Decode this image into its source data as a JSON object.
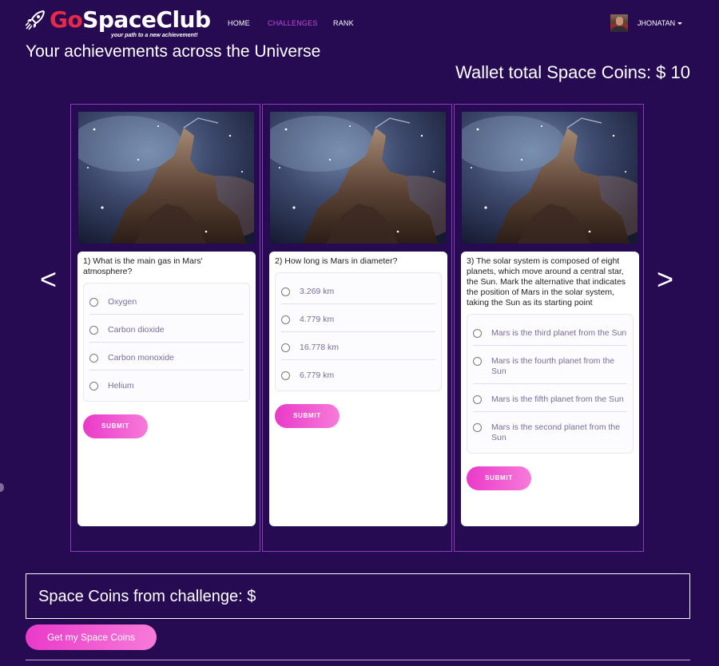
{
  "brand": {
    "prefix": "Go",
    "name": "SpaceClub",
    "tagline": "your path to a new achievement!"
  },
  "nav": {
    "items": [
      {
        "label": "HOME",
        "active": false
      },
      {
        "label": "CHALLENGES",
        "active": true
      },
      {
        "label": "RANK",
        "active": false
      }
    ],
    "user_name": "JHONATAN"
  },
  "headline": "Your achievements across the Universe",
  "wallet": {
    "label": "Wallet total Space Coins: $ 10"
  },
  "carousel": {
    "prev_label": "<",
    "next_label": ">",
    "challenges": [
      {
        "question": "1) What is the main gas in Mars' atmosphere?",
        "options": [
          "Oxygen",
          "Carbon dioxide",
          "Carbon monoxide",
          "Helium"
        ],
        "submit_label": "SUBMIT"
      },
      {
        "question": "2) How long is Mars in diameter?",
        "options": [
          "3.269 km",
          "4.779 km",
          "16.778 km",
          "6.779 km"
        ],
        "submit_label": "SUBMIT"
      },
      {
        "question": "3) The solar system is composed of eight planets, which move around a central star, the Sun. Mark the alternative that indicates the position of Mars in the solar system, taking the Sun as its starting point",
        "options": [
          "Mars is the third planet from the Sun",
          "Mars is the fourth planet from the Sun",
          "Mars is the fifth planet from the Sun",
          "Mars is the second planet from the Sun"
        ],
        "submit_label": "SUBMIT"
      }
    ]
  },
  "earn": {
    "label": "Space Coins from challenge: $",
    "button_label": "Get my Space Coins"
  },
  "colors": {
    "background": "#260b52",
    "accent_pink": "#e93ac9",
    "active_nav": "#c04bd8",
    "brand_red": "#e8284a"
  }
}
